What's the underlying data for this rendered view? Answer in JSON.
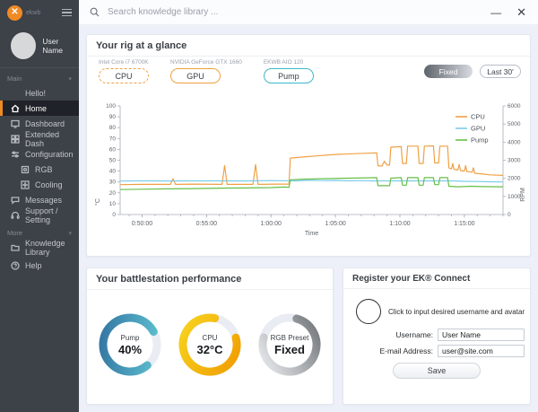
{
  "topbar": {
    "search_placeholder": "Search knowledge library ...",
    "minimize_glyph": "—",
    "close_glyph": "✕"
  },
  "sidebar": {
    "logo_glyph": "✕",
    "logo_text": "ekwb",
    "user_name": "User Name",
    "main_section": "Main",
    "more_section": "More",
    "chevron_glyph": "▾",
    "items": [
      {
        "label": "Hello!"
      },
      {
        "label": "Home"
      },
      {
        "label": "Dashboard"
      },
      {
        "label": "Extended Dash"
      },
      {
        "label": "Configuration"
      },
      {
        "label": "RGB"
      },
      {
        "label": "Cooling"
      },
      {
        "label": "Messages"
      },
      {
        "label": "Support / Setting"
      },
      {
        "label": "Knowledge Library"
      },
      {
        "label": "Help"
      }
    ]
  },
  "rig_panel": {
    "title": "Your rig at a glance",
    "devices": [
      {
        "name": "Intel Core i7 6700K",
        "chip": "CPU"
      },
      {
        "name": "NVIDIA GeForce GTX 1660",
        "chip": "GPU"
      },
      {
        "name": "EKWB AIO 120",
        "chip": "Pump"
      }
    ],
    "mode_buttons": [
      {
        "label": "Fixed",
        "active": true
      },
      {
        "label": "Last 30'",
        "active": false
      }
    ]
  },
  "chart_data": {
    "type": "line",
    "xlabel": "Time",
    "ylabel_left": "°C",
    "ylabel_right": "RPM",
    "x_range": [
      48.3,
      78
    ],
    "ylim_left": [
      0,
      100
    ],
    "ylim_right": [
      0,
      6000
    ],
    "xticks": [
      {
        "t": 50,
        "label": "0:50:00"
      },
      {
        "t": 55,
        "label": "0:55:00"
      },
      {
        "t": 60,
        "label": "1:00:00"
      },
      {
        "t": 65,
        "label": "1:05:00"
      },
      {
        "t": 70,
        "label": "1:10:00"
      },
      {
        "t": 75,
        "label": "1:15:00"
      }
    ],
    "yticks_left": [
      0,
      10,
      20,
      30,
      40,
      50,
      60,
      70,
      80,
      90,
      100
    ],
    "yticks_right": [
      0,
      1000,
      2000,
      3000,
      4000,
      5000,
      6000
    ],
    "minor_x_step": 1,
    "grid": false,
    "legend_position": "top-right",
    "series": [
      {
        "name": "CPU",
        "color": "#f0a044",
        "points": [
          [
            48.3,
            27.5
          ],
          [
            50,
            27.8
          ],
          [
            52.2,
            27.8
          ],
          [
            52.4,
            33
          ],
          [
            52.6,
            27.8
          ],
          [
            54,
            28
          ],
          [
            56.2,
            27.8
          ],
          [
            56.4,
            45
          ],
          [
            56.6,
            27.8
          ],
          [
            58.6,
            27.8
          ],
          [
            58.8,
            46
          ],
          [
            59.0,
            27.8
          ],
          [
            60.5,
            28
          ],
          [
            61.4,
            28
          ],
          [
            61.5,
            52
          ],
          [
            62.5,
            53
          ],
          [
            63.5,
            54
          ],
          [
            65,
            55.3
          ],
          [
            66.5,
            56
          ],
          [
            68.2,
            56.8
          ],
          [
            68.3,
            45
          ],
          [
            68.6,
            44.5
          ],
          [
            68.8,
            49
          ],
          [
            69.0,
            45.5
          ],
          [
            69.2,
            45.5
          ],
          [
            69.3,
            62
          ],
          [
            70.1,
            62.5
          ],
          [
            70.2,
            47
          ],
          [
            70.5,
            47
          ],
          [
            70.6,
            63
          ],
          [
            71.4,
            63
          ],
          [
            71.5,
            47
          ],
          [
            71.8,
            47
          ],
          [
            71.9,
            63
          ],
          [
            72.6,
            63.2
          ],
          [
            72.7,
            47.5
          ],
          [
            73.0,
            47.5
          ],
          [
            73.1,
            63
          ],
          [
            73.7,
            63
          ],
          [
            73.8,
            43
          ],
          [
            74.0,
            42
          ],
          [
            74.1,
            47
          ],
          [
            74.2,
            41.5
          ],
          [
            74.5,
            41
          ],
          [
            74.6,
            46
          ],
          [
            74.7,
            40.5
          ],
          [
            75.0,
            40
          ],
          [
            75.1,
            45
          ],
          [
            75.2,
            39.5
          ],
          [
            75.6,
            39
          ],
          [
            75.7,
            43
          ],
          [
            75.8,
            38
          ],
          [
            76.3,
            37.5
          ],
          [
            77,
            36.5
          ],
          [
            78,
            36
          ]
        ]
      },
      {
        "name": "GPU",
        "color": "#7cccea",
        "points": [
          [
            48.3,
            30.8
          ],
          [
            50,
            31
          ],
          [
            52,
            30.9
          ],
          [
            54,
            31
          ],
          [
            56,
            31
          ],
          [
            58,
            30.9
          ],
          [
            60,
            31.2
          ],
          [
            62,
            31
          ],
          [
            63,
            31.5
          ],
          [
            64,
            31.2
          ],
          [
            65,
            31.4
          ],
          [
            66,
            31
          ],
          [
            67,
            31.2
          ],
          [
            68,
            31
          ],
          [
            69,
            31
          ],
          [
            70,
            31
          ],
          [
            71,
            31
          ],
          [
            72,
            31
          ],
          [
            73,
            31
          ],
          [
            74,
            31
          ],
          [
            75,
            30.6
          ],
          [
            76,
            30.4
          ],
          [
            77,
            30.2
          ],
          [
            78,
            30
          ]
        ]
      },
      {
        "name": "Pump",
        "color": "#67bf46",
        "points": [
          [
            48.3,
            23
          ],
          [
            50,
            23.3
          ],
          [
            52,
            23.6
          ],
          [
            54,
            23.9
          ],
          [
            56,
            24.3
          ],
          [
            58,
            24.5
          ],
          [
            60,
            24.8
          ],
          [
            61.0,
            25.3
          ],
          [
            61.4,
            25.1
          ],
          [
            61.5,
            32
          ],
          [
            62.5,
            32.6
          ],
          [
            64,
            33
          ],
          [
            66,
            33.5
          ],
          [
            67.5,
            33.8
          ],
          [
            68.2,
            34
          ],
          [
            68.3,
            26.5
          ],
          [
            69.2,
            26.5
          ],
          [
            69.3,
            33.5
          ],
          [
            70.1,
            34
          ],
          [
            70.2,
            27
          ],
          [
            70.5,
            27
          ],
          [
            70.6,
            34
          ],
          [
            71.4,
            34
          ],
          [
            71.5,
            27
          ],
          [
            71.8,
            27
          ],
          [
            71.9,
            34
          ],
          [
            72.6,
            34
          ],
          [
            72.7,
            27.5
          ],
          [
            73.0,
            27.5
          ],
          [
            73.1,
            34
          ],
          [
            73.7,
            34
          ],
          [
            73.8,
            26
          ],
          [
            74.5,
            25.5
          ],
          [
            75.5,
            26
          ],
          [
            76.5,
            25.7
          ],
          [
            78,
            25.5
          ]
        ]
      }
    ]
  },
  "performance_panel": {
    "title": "Your battlestation performance",
    "gauges": [
      {
        "label": "Pump",
        "value": "40%",
        "pct": 0.78,
        "rotate": 50,
        "from": "#63c9d6",
        "to": "#2f6f9e",
        "grad": [
          1,
          0,
          0,
          1
        ]
      },
      {
        "label": "CPU",
        "value": "32°C",
        "pct": 0.82,
        "rotate": -15,
        "from": "#f8d41f",
        "to": "#f09c00",
        "grad": [
          0,
          0,
          1,
          1
        ]
      },
      {
        "label": "RGB Preset",
        "value": "Fixed",
        "pct": 0.75,
        "rotate": -75,
        "from": "#eceef1",
        "to": "#6f7377",
        "grad": [
          0,
          0,
          1,
          1
        ]
      }
    ]
  },
  "register_panel": {
    "title": "Register your EK® Connect",
    "avatar_hint": "Click to input desired username and avatar",
    "username_label": "Username:",
    "username_value": "User Name",
    "email_label": "E-mail Address:",
    "email_value": "user@site.com",
    "save_label": "Save"
  }
}
